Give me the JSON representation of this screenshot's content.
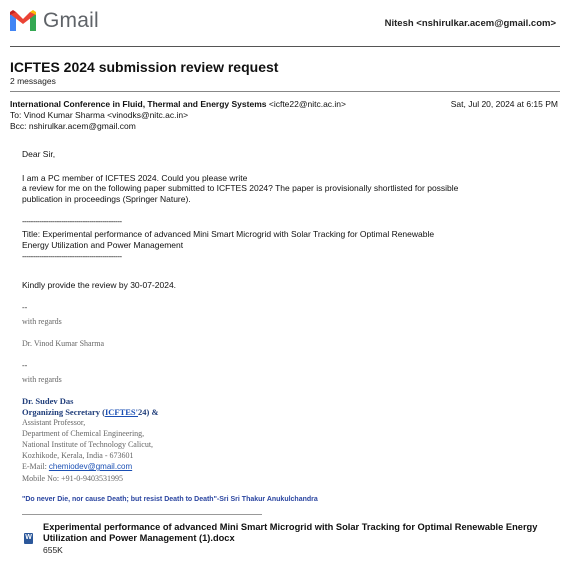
{
  "header": {
    "app_name": "Gmail",
    "logo_icon": "gmail-m-logo-icon",
    "account": "Nitesh <nshirulkar.acem@gmail.com>"
  },
  "thread": {
    "subject": "ICFTES 2024 submission review request",
    "message_count": "2 messages"
  },
  "message": {
    "from_name": "International Conference in Fluid, Thermal and Energy Systems",
    "from_email": "<icfte22@nitc.ac.in>",
    "date": "Sat, Jul 20, 2024 at 6:15 PM",
    "to": "To: Vinod Kumar Sharma <vinodks@nitc.ac.in>",
    "bcc": "Bcc: nshirulkar.acem@gmail.com",
    "greeting": "Dear Sir,",
    "para1_line1": "I am a PC member of ICFTES 2024. Could you please write",
    "para1_line2": "a review for me on the following paper submitted to ICFTES 2024? The paper is provisionally shortlisted for possible",
    "para1_line3": "publication in proceedings (Springer Nature).",
    "divider": "------------------------------------------------",
    "title_line1": "Title:  Experimental performance of advanced Mini Smart Microgrid with Solar Tracking for Optimal Renewable",
    "title_line2": "Energy Utilization and Power Management",
    "deadline": "Kindly provide the review by 30-07-2024.",
    "sig_sep1": "--",
    "regards1": "with regards",
    "name1": "Dr. Vinod Kumar Sharma",
    "sig_sep2": "--",
    "regards2": "with regards",
    "sig_name": "Dr. Sudev Das",
    "sig_role_prefix": "Organizing Secretary (",
    "sig_role_link": "ICFTES'",
    "sig_role_suffix": "24) &",
    "sig_title": "Assistant Professor,",
    "sig_dept": "Department of Chemical Engineering,",
    "sig_inst": "National Institute of Technology Calicut,",
    "sig_loc": "Kozhikode, Kerala, India - 673601",
    "sig_email_label": "E-Mail: ",
    "sig_email": "chemiodev@gmail.com",
    "sig_mobile": "Mobile No: +91-0-9403531995",
    "quote": "\"Do never Die, nor cause Death; but resist Death to Death\"-Sri Sri Thakur Anukulchandra"
  },
  "attachment": {
    "icon": "word-document-icon",
    "name": "Experimental performance of advanced Mini Smart Microgrid with Solar Tracking for Optimal Renewable Energy Utilization and Power Management (1).docx",
    "size": "655K"
  }
}
